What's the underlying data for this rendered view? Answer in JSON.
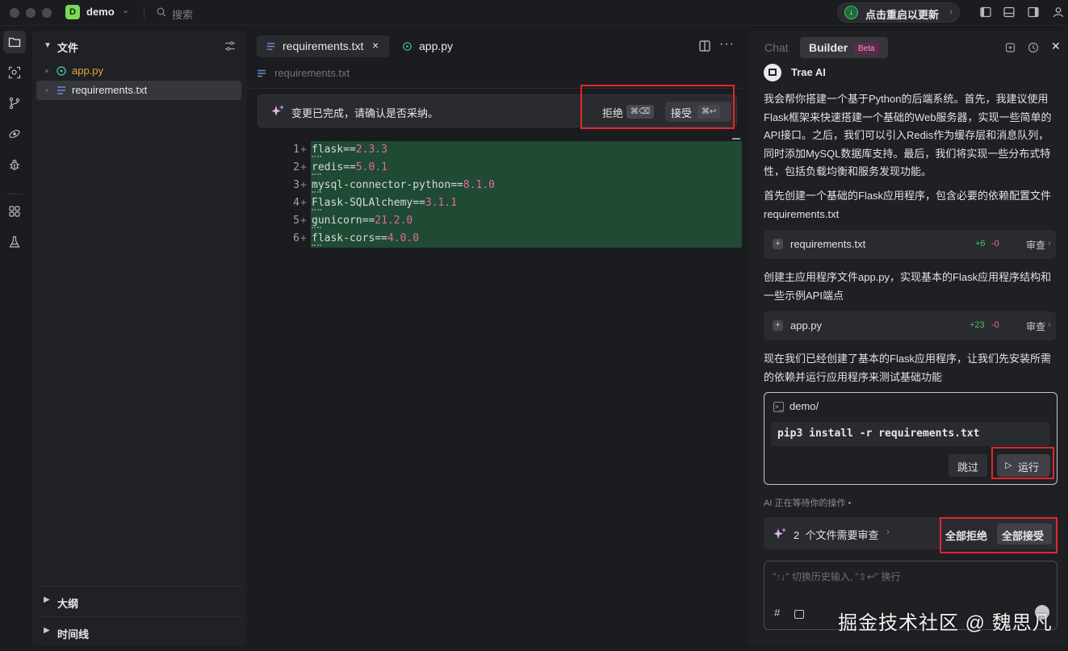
{
  "titlebar": {
    "project_initial": "D",
    "project_name": "demo",
    "search_placeholder": "搜索",
    "update_label": "点击重启以更新"
  },
  "explorer": {
    "title": "文件",
    "files": [
      {
        "name": "app.py",
        "icon": "python-file-icon",
        "color": "#e0a83a"
      },
      {
        "name": "requirements.txt",
        "icon": "text-file-icon",
        "color": "#e6e7ea"
      }
    ],
    "sections": [
      "大纲",
      "时间线"
    ]
  },
  "editor": {
    "tabs": [
      {
        "label": "requirements.txt",
        "close": "×"
      },
      {
        "label": "app.py"
      }
    ],
    "breadcrumb": "requirements.txt",
    "review_bar": {
      "message": "变更已完成，请确认是否采纳。",
      "reject_label": "拒绝",
      "reject_kbd": "⌘⌫",
      "accept_label": "接受",
      "accept_kbd": "⌘↩"
    },
    "lines": [
      {
        "num": "1",
        "pkg": "flask",
        "ver": "2.3.3"
      },
      {
        "num": "2",
        "pkg": "redis",
        "ver": "5.0.1"
      },
      {
        "num": "3",
        "pkg": "mysql-connector-python",
        "ver": "8.1.0"
      },
      {
        "num": "4",
        "pkg": "Flask-SQLAlchemy",
        "ver": "3.1.1"
      },
      {
        "num": "5",
        "pkg": "gunicorn",
        "ver": "21.2.0"
      },
      {
        "num": "6",
        "pkg": "flask-cors",
        "ver": "4.0.0"
      }
    ]
  },
  "ai_panel": {
    "tabs": {
      "chat": "Chat",
      "builder": "Builder",
      "beta": "Beta"
    },
    "assistant_name": "Trae AI",
    "messages": [
      "我会帮你搭建一个基于Python的后端系统。首先，我建议使用Flask框架来快速搭建一个基础的Web服务器，实现一些简单的API接口。之后，我们可以引入Redis作为缓存层和消息队列，同时添加MySQL数据库支持。最后，我们将实现一些分布式特性，包括负载均衡和服务发现功能。",
      "首先创建一个基础的Flask应用程序，包含必要的依赖配置文件requirements.txt",
      "创建主应用程序文件app.py，实现基本的Flask应用程序结构和一些示例API端点",
      "现在我们已经创建了基本的Flask应用程序，让我们先安装所需的依赖并运行应用程序来测试基础功能"
    ],
    "file_cards": [
      {
        "name": "requirements.txt",
        "added": "+6",
        "removed": "-0",
        "action": "审查"
      },
      {
        "name": "app.py",
        "added": "+23",
        "removed": "-0",
        "action": "审查"
      }
    ],
    "terminal": {
      "path": "demo/",
      "command": "pip3 install -r requirements.txt",
      "skip_label": "跳过",
      "run_label": "运行"
    },
    "status": "AI 正在等待你的操作 •",
    "review_all": {
      "count": "2",
      "text": "个文件需要审查",
      "reject_all": "全部拒绝",
      "accept_all": "全部接受"
    },
    "input_placeholder": "\"↑↓\" 切换历史输入, \"⇧↩\" 换行"
  },
  "watermark": "掘金技术社区 @ 魏思凡",
  "colors": {
    "diff_added_bg": "#1f4a33",
    "version_pink": "#e26b9b",
    "added_green": "#3ec26a",
    "highlight_red": "#e3262e",
    "project_badge": "#7cd957"
  }
}
